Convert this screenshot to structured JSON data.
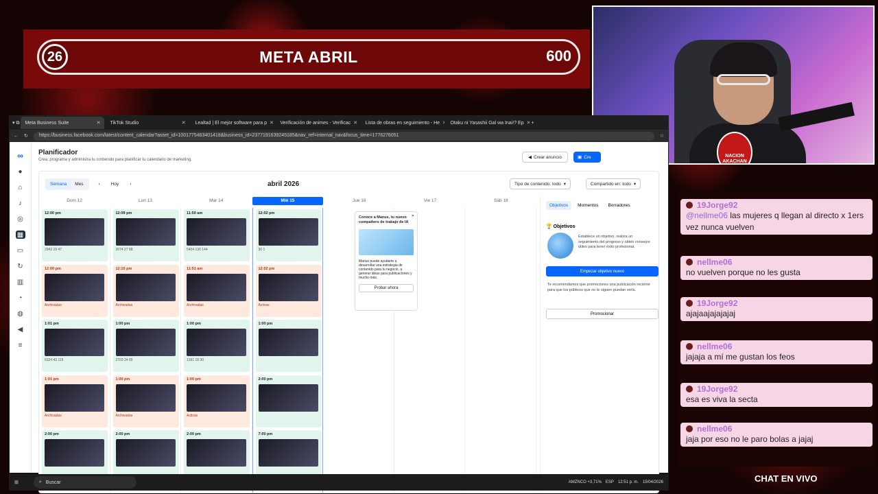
{
  "goal": {
    "current": "26",
    "title": "META ABRIL",
    "max": "600"
  },
  "cam": {
    "badge": "NACION AKACHAN"
  },
  "browser": {
    "tabs": [
      {
        "label": "Meta Business Suite",
        "active": true
      },
      {
        "label": "TikTok Studio",
        "active": false
      },
      {
        "label": "Lealtad | El mejor software para p",
        "active": false
      },
      {
        "label": "Verificación de animes - Verificac",
        "active": false
      },
      {
        "label": "Lista de obras en seguimiento - He",
        "active": false
      },
      {
        "label": "Otaku ni Yasashii Gal wa Inai!? Ep",
        "active": false
      }
    ],
    "url": "https://business.facebook.com/latest/content_calendar?asset_id=1001775483401418&business_id=2377191639245185&nav_ref=internal_nav&focus_time=1776276051"
  },
  "app": {
    "title": "Planificador",
    "subtitle": "Crea, programa y administra tu contenido para planificar tu calendario de marketing.",
    "create_ad": "Crear anuncio",
    "create": "Cre",
    "view_week": "Semana",
    "view_month": "Mes",
    "today": "Hoy",
    "month": "abril 2026",
    "content_type": "Tipo de contenido: todo",
    "shared_on": "Compartido en: todo",
    "days": [
      "Dom 12",
      "Lun 13",
      "Mar 14",
      "Mié 15",
      "Jue 16",
      "Vie 17",
      "Sáb 18"
    ],
    "columns": [
      {
        "posts": [
          {
            "time": "12:00 pm",
            "status": "pub",
            "stats": "2942  19  47"
          },
          {
            "time": "12:00 pm",
            "status": "arc",
            "stats": "Archivadas"
          },
          {
            "time": "1:01 pm",
            "status": "pub",
            "stats": "6324  43  115"
          },
          {
            "time": "1:01 pm",
            "status": "arc",
            "stats": "Archivadas"
          },
          {
            "time": "2:00 pm",
            "status": "pub",
            "stats": ""
          }
        ]
      },
      {
        "posts": [
          {
            "time": "12:09 pm",
            "status": "pub",
            "stats": "2674  27  88"
          },
          {
            "time": "12:10 pm",
            "status": "arc",
            "stats": "Archivadas"
          },
          {
            "time": "1:00 pm",
            "status": "pub",
            "stats": "2703  24  65"
          },
          {
            "time": "1:00 pm",
            "status": "arc",
            "stats": "Archivadas"
          },
          {
            "time": "2:00 pm",
            "status": "pub",
            "stats": ""
          }
        ]
      },
      {
        "posts": [
          {
            "time": "11:50 am",
            "status": "pub",
            "stats": "5404  130  144"
          },
          {
            "time": "11:51 am",
            "status": "arc",
            "stats": "Archivadas"
          },
          {
            "time": "1:00 pm",
            "status": "pub",
            "stats": "1391  18  30"
          },
          {
            "time": "1:00 pm",
            "status": "arc",
            "stats": "Activas"
          },
          {
            "time": "2:00 pm",
            "status": "pub",
            "stats": ""
          }
        ]
      },
      {
        "posts": [
          {
            "time": "12:02 pm",
            "status": "pub",
            "stats": "30  1"
          },
          {
            "time": "12:02 pm",
            "status": "arc",
            "stats": "Activas"
          },
          {
            "time": "1:00 pm",
            "status": "pub",
            "stats": ""
          },
          {
            "time": "2:00 pm",
            "status": "pub",
            "stats": ""
          },
          {
            "time": "7:00 pm",
            "status": "pub",
            "stats": ""
          }
        ]
      }
    ],
    "promo": {
      "title": "Conoce a Manus, tu nuevo compañero de trabajo de IA",
      "body": "Manus puede ayudarte a desarrollar una estrategia de contenido para tu negocio, a generar ideas para publicaciones y mucho más.",
      "button": "Probar ahora"
    },
    "side": {
      "tabs": [
        "Objetivos",
        "Momentos",
        "Borradores"
      ],
      "heading": "Objetivos",
      "desc": "Establece un objetivo, realiza un seguimiento del progreso y obtén consejos útiles para tener éxito profesional.",
      "primary": "Empezar objetivo nuevo",
      "rec": "Te recomendamos que promociones una publicación reciente para que los públicos que no te siguen puedan verla.",
      "secondary": "Promocionar"
    }
  },
  "taskbar": {
    "search": "Buscar",
    "ticker": "AMZNCO +3,71%",
    "lang": "ESP",
    "time": "12:51 p. m.",
    "date": "15/04/2026"
  },
  "chat": {
    "label": "CHAT EN VIVO",
    "messages": [
      {
        "user": "19Jorge92",
        "mention": "@nellme06",
        "text": " las mujeres q llegan al directo x 1ers vez nunca vuelven"
      },
      {
        "user": "nellme06",
        "mention": "",
        "text": "no vuelven porque no les gusta"
      },
      {
        "user": "19Jorge92",
        "mention": "",
        "text": "ajajaajajajajaj"
      },
      {
        "user": "nellme06",
        "mention": "",
        "text": "jajaja a mí me gustan los feos"
      },
      {
        "user": "19Jorge92",
        "mention": "",
        "text": "esa es viva la secta"
      },
      {
        "user": "nellme06",
        "mention": "",
        "text": "jaja por eso no le paro bolas a jajaj"
      }
    ]
  }
}
